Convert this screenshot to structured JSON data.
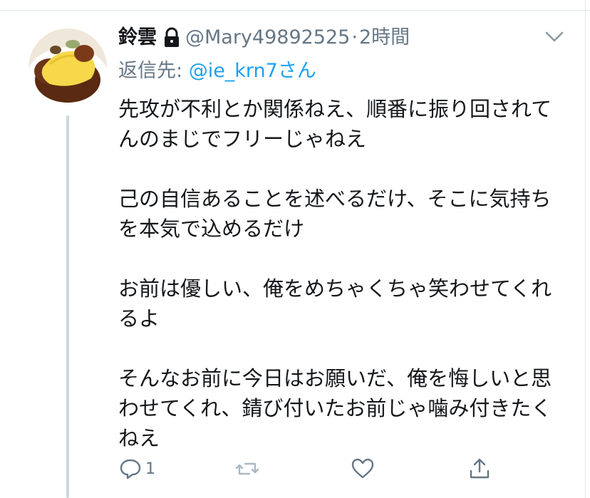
{
  "tweet": {
    "display_name": "鈴雲",
    "handle": "@Mary49892525",
    "separator": "·",
    "time": "2時間",
    "reply_to_label": "返信先: ",
    "reply_to_mention": "@ie_krn7さん",
    "paragraphs": [
      "先攻が不利とか関係ねえ、順番に振り回されてんのまじでフリーじゃねえ",
      "己の自信あることを述べるだけ、そこに気持ちを本気で込めるだけ",
      "お前は優しい、俺をめちゃくちゃ笑わせてくれるよ",
      "そんなお前に今日はお願いだ、俺を悔しいと思わせてくれ、錆び付いたお前じゃ噛み付きたくねえ"
    ]
  },
  "actions": {
    "reply_count": "1",
    "icons": [
      "reply-icon",
      "retweet-icon",
      "like-icon",
      "share-icon"
    ]
  },
  "colors": {
    "text": "#14171a",
    "secondary": "#657786",
    "link": "#1da1f2",
    "divider": "#e1e8ed",
    "thread_line": "#ccd6dd"
  }
}
